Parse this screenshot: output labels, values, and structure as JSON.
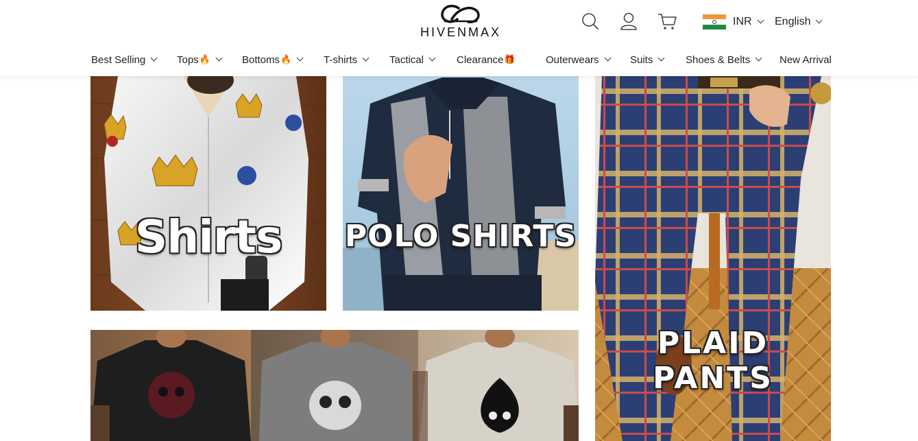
{
  "header": {
    "logo_text": "HIVENMAX",
    "icons": [
      "search-icon",
      "user-icon",
      "cart-icon"
    ],
    "currency": "INR",
    "language": "English"
  },
  "nav": {
    "items": [
      {
        "label": "Best Selling",
        "emoji": "",
        "has_dropdown": true
      },
      {
        "label": "Tops",
        "emoji": "🔥",
        "has_dropdown": true
      },
      {
        "label": "Bottoms",
        "emoji": "🔥",
        "has_dropdown": true
      },
      {
        "label": "T-shirts",
        "emoji": "",
        "has_dropdown": true
      },
      {
        "label": "Tactical",
        "emoji": "",
        "has_dropdown": true
      },
      {
        "label": "Clearance",
        "emoji": "🎁",
        "has_dropdown": false
      },
      {
        "label": "Outerwears",
        "emoji": "",
        "has_dropdown": true
      },
      {
        "label": "Suits",
        "emoji": "",
        "has_dropdown": true
      },
      {
        "label": "Shoes & Belts",
        "emoji": "",
        "has_dropdown": true
      },
      {
        "label": "New Arrival",
        "emoji": "",
        "has_dropdown": false
      }
    ]
  },
  "banners": {
    "shirts": {
      "title": "Shirts"
    },
    "polo": {
      "title": "POLO SHIRTS"
    },
    "plaid": {
      "title": "PLAID PANTS"
    },
    "tees": {
      "title": ""
    }
  },
  "colors": {
    "flag_saffron": "#f39533",
    "flag_white": "#ffffff",
    "flag_green": "#1c8a3f",
    "text": "#222222"
  }
}
